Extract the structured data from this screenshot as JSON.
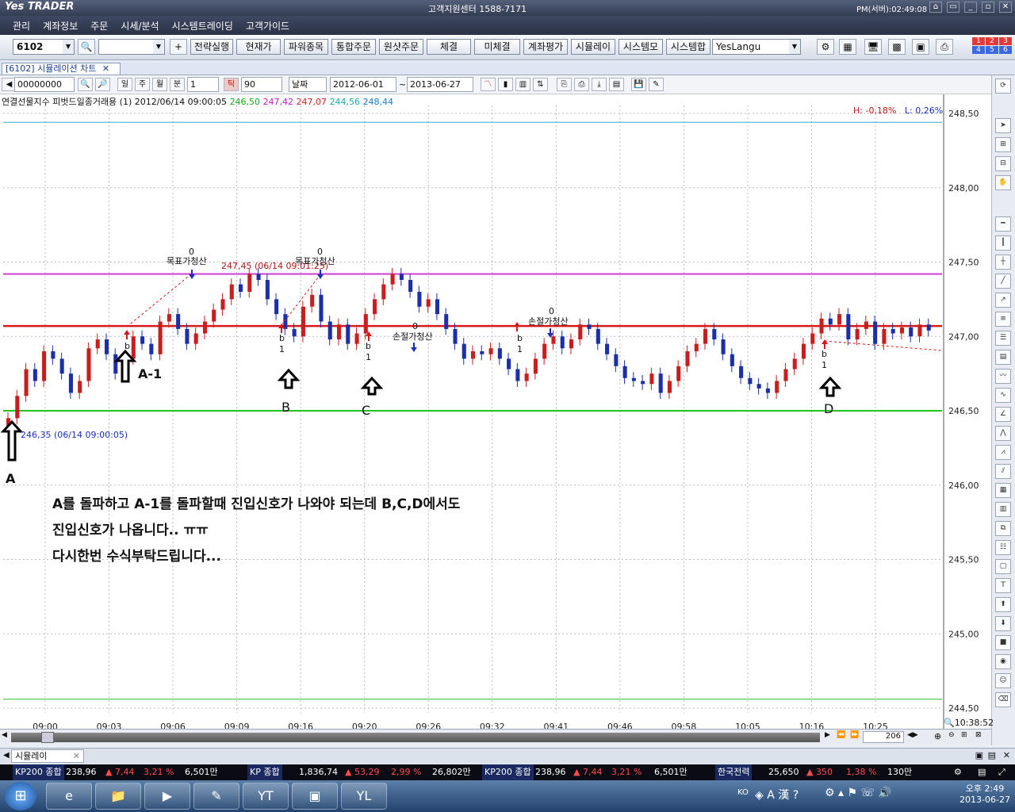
{
  "app": {
    "logo": "Yes TRADER",
    "center_text": "고객지원센터 1588-7171",
    "clock": "PM(서버):02:49:08",
    "window_buttons": [
      "⌂",
      "▭",
      "_",
      "▫",
      "✕"
    ]
  },
  "menu": [
    "관리",
    "계좌정보",
    "주문",
    "시세/분석",
    "시스템트레이딩",
    "고객가이드"
  ],
  "toolbar": {
    "screen_no": "6102",
    "buttons": [
      "전략실행",
      "현재가",
      "파워종목",
      "통합주문",
      "원샷주문",
      "체결",
      "미체결",
      "계좌평가",
      "시뮬레이",
      "시스템모",
      "시스템합"
    ],
    "lang_select": "YesLangu",
    "layout_nums": [
      "1",
      "2",
      "3",
      "4",
      "5",
      "6"
    ]
  },
  "window": {
    "tab_title": "[6102] 시뮬레이션 차트",
    "close": "✕"
  },
  "chart_toolbar": {
    "code": "00000000",
    "periods": [
      "일",
      "주",
      "월",
      "분",
      "틱"
    ],
    "interval": "1",
    "tick_value": "90",
    "date_mode": "날짜",
    "date_from": "2012-06-01",
    "sep": "~",
    "date_to": "2013-06-27"
  },
  "indicator": {
    "label": "연결선물지수 피벗드일종거래용  (1) 2012/06/14 09:00:05",
    "v1": "246,50",
    "v2": "247,42",
    "v3": "247,07",
    "v4": "244,56",
    "v5": "248,44"
  },
  "hl": {
    "h": "H: -0,18%",
    "l": "L: 0,26%"
  },
  "annotations": {
    "top_label_1": "247,45 (06/14 09:01:25)",
    "bottom_label": "246,35 (06/14 09:00:05)",
    "exit_target": "목표가청산",
    "exit_stop": "손절가청산",
    "zero": "0",
    "one": "1",
    "b": "b"
  },
  "markers": {
    "a": "A",
    "a1": "A-1",
    "b": "B",
    "c": "C",
    "d": "D"
  },
  "notes": [
    "A를 돌파하고 A-1를 돌파할때 진입신호가 나와야 되는데 B,C,D에서도",
    "진입신호가 나옵니다.. ㅠㅠ",
    "다시한번 수식부탁드립니다..."
  ],
  "scroll": {
    "zoom": "206",
    "time_end": "10:38:52"
  },
  "bottom_tab": "시뮬레이",
  "ticker": [
    {
      "name": "KP200 종합",
      "price": "238,96",
      "chg": "▲ 7,44",
      "pct": "3,21 %",
      "vol": "6,501만"
    },
    {
      "name": "KP 종합",
      "price": "1,836,74",
      "chg": "▲ 53,29",
      "pct": "2,99 %",
      "vol": "26,802만"
    },
    {
      "name": "KP200 종합",
      "price": "238,96",
      "chg": "▲ 7,44",
      "pct": "3,21 %",
      "vol": "6,501만"
    },
    {
      "name": "한국전력",
      "price": "25,650",
      "chg": "▲ 350",
      "pct": "1,38 %",
      "vol": "130만"
    }
  ],
  "taskbar": {
    "lang": "KO",
    "time": "오후 2:49",
    "date": "2013-06-27"
  },
  "colors": {
    "up_bar": "#c81e1e",
    "down_bar": "#1a2fa8",
    "resist_magenta": "#d03cd0",
    "entry_red": "#d81818",
    "support_green": "#22c222",
    "cyan": "#30b0d0"
  },
  "chart_data": {
    "type": "bar",
    "y_axis_ticks": [
      "248,50",
      "248,00",
      "247,50",
      "247,00",
      "246,50",
      "246,00",
      "245,50",
      "245,00",
      "244,50"
    ],
    "ylim": [
      244.5,
      248.5
    ],
    "x_tick_labels": [
      "09:00",
      "09:03",
      "09:06",
      "09:09",
      "09:16",
      "09:20",
      "09:26",
      "09:32",
      "09:41",
      "09:46",
      "09:58",
      "10:05",
      "10:16",
      "10:25"
    ],
    "horizontal_lines": [
      {
        "name": "resistance",
        "value": 247.42,
        "color": "#d03cd0"
      },
      {
        "name": "entry",
        "value": 247.07,
        "color": "#d81818"
      },
      {
        "name": "support",
        "value": 246.5,
        "color": "#22c222"
      },
      {
        "name": "upper",
        "value": 248.44,
        "color": "#30b0d0"
      },
      {
        "name": "lower",
        "value": 244.56,
        "color": "#22c222"
      }
    ],
    "closes": [
      246.45,
      246.6,
      246.78,
      246.7,
      246.9,
      246.85,
      246.75,
      246.62,
      246.7,
      246.92,
      246.98,
      246.88,
      246.75,
      246.85,
      247.0,
      246.95,
      246.88,
      247.1,
      247.15,
      247.05,
      246.95,
      247.02,
      247.1,
      247.18,
      247.25,
      247.35,
      247.3,
      247.42,
      247.38,
      247.25,
      247.15,
      247.05,
      247.0,
      247.2,
      247.28,
      247.1,
      246.98,
      247.08,
      246.95,
      247.02,
      247.15,
      247.25,
      247.35,
      247.42,
      247.38,
      247.3,
      247.2,
      247.25,
      247.15,
      247.05,
      246.95,
      246.85,
      246.9,
      246.88,
      246.92,
      246.85,
      246.78,
      246.7,
      246.75,
      246.85,
      246.95,
      247.0,
      246.92,
      246.98,
      247.08,
      247.05,
      246.95,
      246.88,
      246.8,
      246.72,
      246.7,
      246.68,
      246.75,
      246.62,
      246.7,
      246.8,
      246.9,
      246.95,
      247.05,
      246.98,
      246.88,
      246.8,
      246.72,
      246.68,
      246.65,
      246.62,
      246.7,
      246.78,
      246.85,
      246.95,
      247.02,
      247.12,
      247.08,
      247.15,
      246.98,
      247.05,
      247.1,
      246.95,
      247.05,
      247.02,
      247.06,
      247.0,
      247.08,
      247.04
    ]
  }
}
